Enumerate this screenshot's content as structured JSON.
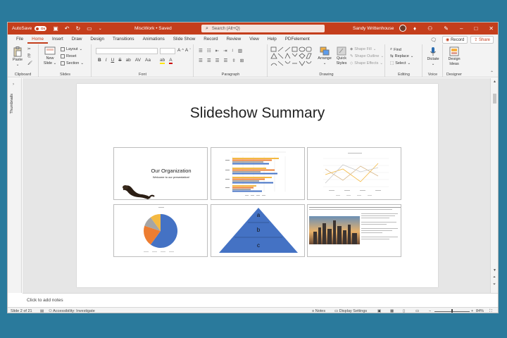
{
  "titlebar": {
    "autosave_label": "AutoSave",
    "autosave_state": "On",
    "doc_title": "MiscWork • Saved",
    "search_placeholder": "Search (Alt+Q)",
    "user_name": "Sandy Writtenhouse"
  },
  "tabs": [
    "File",
    "Home",
    "Insert",
    "Draw",
    "Design",
    "Transitions",
    "Animations",
    "Slide Show",
    "Record",
    "Review",
    "View",
    "Help",
    "PDFelement"
  ],
  "active_tab": "Home",
  "tabs_right": {
    "record_label": "Record",
    "share_label": "Share"
  },
  "ribbon": {
    "groups": {
      "clipboard": "Clipboard",
      "slides": "Slides",
      "font": "Font",
      "paragraph": "Paragraph",
      "drawing": "Drawing",
      "editing": "Editing",
      "voice": "Voice",
      "designer": "Designer"
    },
    "paste": "Paste",
    "new_slide_1": "New",
    "new_slide_2": "Slide",
    "layout": "Layout",
    "reset": "Reset",
    "section": "Section",
    "arrange": "Arrange",
    "quick_styles_1": "Quick",
    "quick_styles_2": "Styles",
    "shape_fill": "Shape Fill",
    "shape_outline": "Shape Outline",
    "shape_effects": "Shape Effects",
    "find": "Find",
    "replace": "Replace",
    "select": "Select",
    "dictate": "Dictate",
    "design_ideas_1": "Design",
    "design_ideas_2": "Ideas"
  },
  "thumbnails_label": "Thumbnails",
  "slide": {
    "title": "Slideshow Summary",
    "thumb1_title": "Our Organization",
    "thumb1_subtitle": "Welcome to our presentation!",
    "pyramid_labels": [
      "a",
      "b",
      "c"
    ]
  },
  "notes_placeholder": "Click to add notes",
  "status": {
    "slide_info": "Slide 2 of 21",
    "accessibility": "Accessibility: Investigate",
    "notes": "Notes",
    "display_settings": "Display Settings",
    "zoom": "84%"
  }
}
